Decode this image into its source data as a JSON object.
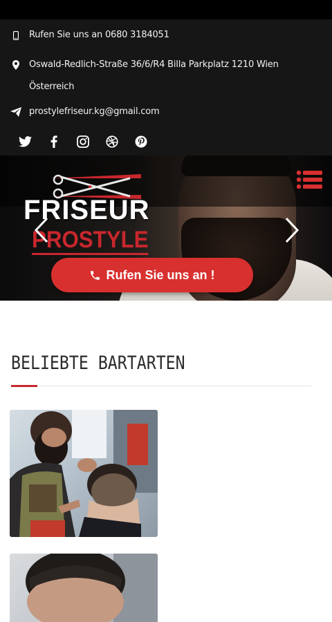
{
  "contact": {
    "phone": "Rufen Sie uns an 0680 3184051",
    "address_line1": "Oswald-Redlich-Straße 36/6/R4 Billa Parkplatz 1210 Wien",
    "address_line2": "Österreich",
    "email": "prostylefriseur.kg@gmail.com"
  },
  "social": [
    "twitter-icon",
    "facebook-icon",
    "instagram-icon",
    "dribbble-icon",
    "pinterest-icon"
  ],
  "logo": {
    "line1": "FRISEUR",
    "line2": "PROSTYLE"
  },
  "hero": {
    "call_button": "Rufen Sie uns an !"
  },
  "section": {
    "title": "BELIEBTE BARTARTEN"
  },
  "colors": {
    "accent": "#c8272d",
    "button": "#d8302f",
    "topbar": "#161616"
  }
}
